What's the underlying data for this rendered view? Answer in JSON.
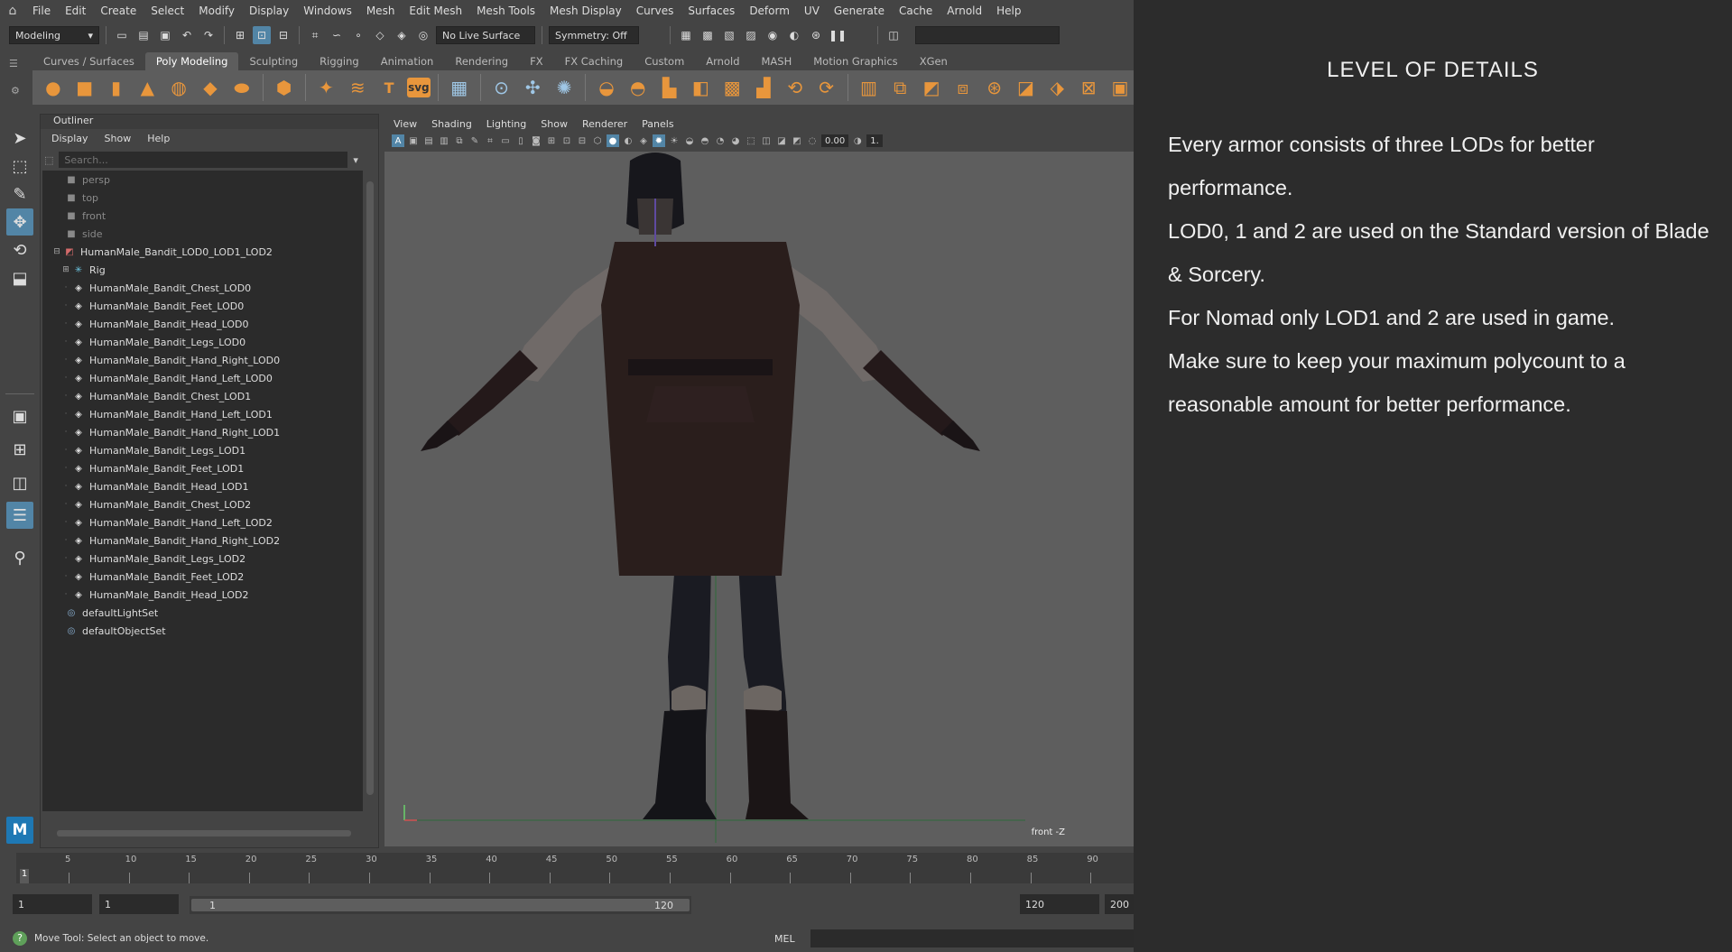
{
  "menubar": {
    "items": [
      "File",
      "Edit",
      "Create",
      "Select",
      "Modify",
      "Display",
      "Windows",
      "Mesh",
      "Edit Mesh",
      "Mesh Tools",
      "Mesh Display",
      "Curves",
      "Surfaces",
      "Deform",
      "UV",
      "Generate",
      "Cache",
      "Arnold",
      "Help"
    ]
  },
  "statusline": {
    "workspace": "Modeling",
    "live_surface": "No Live Surface",
    "symmetry": "Symmetry: Off"
  },
  "shelf": {
    "tabs": [
      "Curves / Surfaces",
      "Poly Modeling",
      "Sculpting",
      "Rigging",
      "Animation",
      "Rendering",
      "FX",
      "FX Caching",
      "Custom",
      "Arnold",
      "MASH",
      "Motion Graphics",
      "XGen"
    ],
    "active_tab": "Poly Modeling",
    "svg_label": "svg",
    "text_label": "T"
  },
  "outliner": {
    "title": "Outliner",
    "menu": [
      "Display",
      "Show",
      "Help"
    ],
    "search_placeholder": "Search...",
    "cameras": [
      "persp",
      "top",
      "front",
      "side"
    ],
    "group": "HumanMale_Bandit_LOD0_LOD1_LOD2",
    "rig": "Rig",
    "meshes": [
      "HumanMale_Bandit_Chest_LOD0",
      "HumanMale_Bandit_Feet_LOD0",
      "HumanMale_Bandit_Head_LOD0",
      "HumanMale_Bandit_Legs_LOD0",
      "HumanMale_Bandit_Hand_Right_LOD0",
      "HumanMale_Bandit_Hand_Left_LOD0",
      "HumanMale_Bandit_Chest_LOD1",
      "HumanMale_Bandit_Hand_Left_LOD1",
      "HumanMale_Bandit_Hand_Right_LOD1",
      "HumanMale_Bandit_Legs_LOD1",
      "HumanMale_Bandit_Feet_LOD1",
      "HumanMale_Bandit_Head_LOD1",
      "HumanMale_Bandit_Chest_LOD2",
      "HumanMale_Bandit_Hand_Left_LOD2",
      "HumanMale_Bandit_Hand_Right_LOD2",
      "HumanMale_Bandit_Legs_LOD2",
      "HumanMale_Bandit_Feet_LOD2",
      "HumanMale_Bandit_Head_LOD2"
    ],
    "sets": [
      "defaultLightSet",
      "defaultObjectSet"
    ]
  },
  "viewport": {
    "menu": [
      "View",
      "Shading",
      "Lighting",
      "Show",
      "Renderer",
      "Panels"
    ],
    "exposure": "0.00",
    "gamma": "1.",
    "camera_label": "front -Z"
  },
  "timeslider": {
    "labels": [
      "5",
      "10",
      "15",
      "20",
      "25",
      "30",
      "35",
      "40",
      "45",
      "50",
      "55",
      "60",
      "65",
      "70",
      "75",
      "80",
      "85",
      "90"
    ],
    "current_frame": "1"
  },
  "range": {
    "start": "1",
    "playback_start": "1",
    "slider_start": "1",
    "slider_end": "120",
    "playback_end": "120",
    "end": "200"
  },
  "helpline": {
    "message": "Move Tool: Select an object to move.",
    "mel_label": "MEL"
  },
  "doc": {
    "title": "LEVEL OF DETAILS",
    "paragraphs": [
      "Every armor consists of three LODs for better performance.",
      "LOD0, 1 and 2 are used on the Standard version of Blade & Sorcery.",
      "For Nomad only LOD1 and 2 are used in game.",
      "Make sure to keep your maximum polycount to a reasonable amount for better performance."
    ]
  },
  "colors": {
    "accent": "#5285a6",
    "shelf_icon": "#e8963c",
    "doc_bg": "#2c2c2c",
    "viewport_bg": "#5e5e5e"
  }
}
